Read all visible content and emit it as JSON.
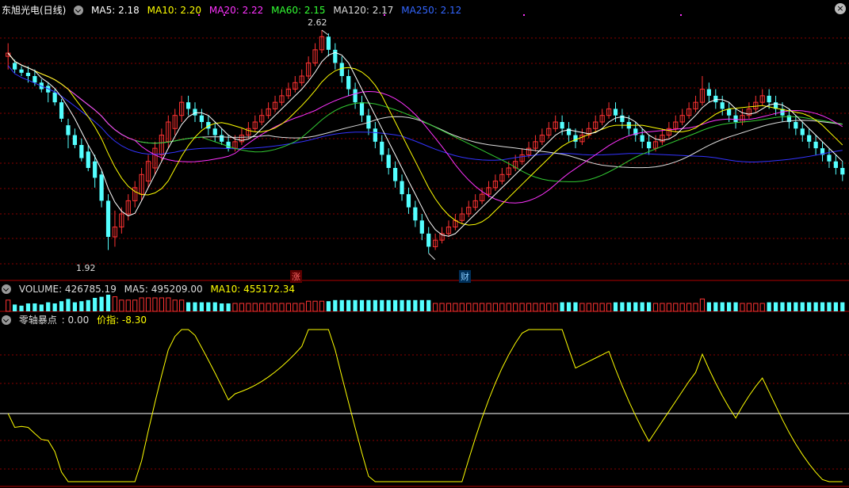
{
  "price_panel": {
    "stock_name": "东旭光电(日线)",
    "indicators": [
      {
        "label": "MA5: 2.18",
        "color": "#ffffff"
      },
      {
        "label": "MA10: 2.20",
        "color": "#ffff00"
      },
      {
        "label": "MA20: 2.22",
        "color": "#ff33ff"
      },
      {
        "label": "MA60: 2.15",
        "color": "#33ff33"
      },
      {
        "label": "MA120: 2.17",
        "color": "#dddddd"
      },
      {
        "label": "MA250: 2.12",
        "color": "#3366ff"
      }
    ],
    "high_label": "2.62",
    "low_label": "1.92",
    "tag_zhang": "涨",
    "tag_cai": "财",
    "close_icon": "close-icon"
  },
  "volume_panel": {
    "label": "VOLUME: 426785.19",
    "ma5": "MA5: 495209.00",
    "ma10": "MA10: 455172.34"
  },
  "osc_panel": {
    "name": "零轴暴点",
    "value": ": 0.00",
    "jiazhi": "价指: -8.30"
  },
  "colors": {
    "up": "#ff3232",
    "down": "#54ffff",
    "grid": "#8a0000",
    "ma5": "#ffffff",
    "ma10": "#ffff00",
    "ma20": "#ff33ff",
    "ma60": "#33cc33",
    "ma120": "#dddddd",
    "ma250": "#3333ff"
  },
  "chart_data": {
    "type": "candlestick",
    "price_range": [
      1.92,
      2.62
    ],
    "candles": [
      [
        2.54,
        2.55,
        2.5,
        2.58
      ],
      [
        2.52,
        2.5,
        2.49,
        2.53
      ],
      [
        2.5,
        2.49,
        2.48,
        2.51
      ],
      [
        2.49,
        2.48,
        2.46,
        2.51
      ],
      [
        2.48,
        2.46,
        2.45,
        2.5
      ],
      [
        2.46,
        2.44,
        2.43,
        2.47
      ],
      [
        2.45,
        2.43,
        2.4,
        2.46
      ],
      [
        2.43,
        2.4,
        2.39,
        2.44
      ],
      [
        2.4,
        2.35,
        2.34,
        2.41
      ],
      [
        2.33,
        2.3,
        2.26,
        2.35
      ],
      [
        2.3,
        2.27,
        2.26,
        2.32
      ],
      [
        2.27,
        2.23,
        2.22,
        2.29
      ],
      [
        2.25,
        2.2,
        2.19,
        2.27
      ],
      [
        2.22,
        2.17,
        2.14,
        2.24
      ],
      [
        2.18,
        2.1,
        2.08,
        2.19
      ],
      [
        2.1,
        1.99,
        1.95,
        2.12
      ],
      [
        1.99,
        2.02,
        1.96,
        2.07
      ],
      [
        2.02,
        2.06,
        2.0,
        2.08
      ],
      [
        2.06,
        2.1,
        2.04,
        2.12
      ],
      [
        2.1,
        2.14,
        2.08,
        2.16
      ],
      [
        2.12,
        2.18,
        2.1,
        2.2
      ],
      [
        2.16,
        2.22,
        2.14,
        2.24
      ],
      [
        2.2,
        2.26,
        2.18,
        2.28
      ],
      [
        2.24,
        2.3,
        2.22,
        2.32
      ],
      [
        2.28,
        2.34,
        2.26,
        2.36
      ],
      [
        2.32,
        2.36,
        2.3,
        2.38
      ],
      [
        2.36,
        2.4,
        2.34,
        2.42
      ],
      [
        2.4,
        2.38,
        2.36,
        2.42
      ],
      [
        2.38,
        2.36,
        2.34,
        2.4
      ],
      [
        2.36,
        2.34,
        2.32,
        2.38
      ],
      [
        2.34,
        2.32,
        2.3,
        2.36
      ],
      [
        2.32,
        2.3,
        2.28,
        2.34
      ],
      [
        2.3,
        2.28,
        2.27,
        2.32
      ],
      [
        2.28,
        2.26,
        2.25,
        2.3
      ],
      [
        2.26,
        2.28,
        2.25,
        2.3
      ],
      [
        2.28,
        2.3,
        2.27,
        2.32
      ],
      [
        2.3,
        2.32,
        2.29,
        2.34
      ],
      [
        2.32,
        2.34,
        2.31,
        2.36
      ],
      [
        2.34,
        2.36,
        2.33,
        2.38
      ],
      [
        2.36,
        2.38,
        2.35,
        2.4
      ],
      [
        2.38,
        2.4,
        2.37,
        2.42
      ],
      [
        2.4,
        2.42,
        2.39,
        2.44
      ],
      [
        2.42,
        2.44,
        2.41,
        2.46
      ],
      [
        2.44,
        2.46,
        2.43,
        2.48
      ],
      [
        2.46,
        2.48,
        2.45,
        2.5
      ],
      [
        2.48,
        2.52,
        2.47,
        2.54
      ],
      [
        2.52,
        2.56,
        2.51,
        2.58
      ],
      [
        2.56,
        2.6,
        2.55,
        2.62
      ],
      [
        2.6,
        2.56,
        2.54,
        2.61
      ],
      [
        2.56,
        2.52,
        2.5,
        2.58
      ],
      [
        2.52,
        2.48,
        2.46,
        2.54
      ],
      [
        2.48,
        2.44,
        2.42,
        2.5
      ],
      [
        2.44,
        2.4,
        2.38,
        2.46
      ],
      [
        2.4,
        2.36,
        2.34,
        2.42
      ],
      [
        2.36,
        2.32,
        2.3,
        2.38
      ],
      [
        2.32,
        2.28,
        2.26,
        2.34
      ],
      [
        2.28,
        2.24,
        2.22,
        2.3
      ],
      [
        2.24,
        2.2,
        2.18,
        2.26
      ],
      [
        2.2,
        2.16,
        2.14,
        2.22
      ],
      [
        2.16,
        2.12,
        2.1,
        2.18
      ],
      [
        2.12,
        2.08,
        2.06,
        2.14
      ],
      [
        2.08,
        2.04,
        2.02,
        2.1
      ],
      [
        2.04,
        2.0,
        1.98,
        2.06
      ],
      [
        2.0,
        1.96,
        1.94,
        2.02
      ],
      [
        1.96,
        1.98,
        1.95,
        2.0
      ],
      [
        1.98,
        2.0,
        1.97,
        2.02
      ],
      [
        2.0,
        2.02,
        1.99,
        2.04
      ],
      [
        2.02,
        2.04,
        2.01,
        2.06
      ],
      [
        2.04,
        2.06,
        2.03,
        2.08
      ],
      [
        2.06,
        2.08,
        2.05,
        2.1
      ],
      [
        2.08,
        2.1,
        2.07,
        2.12
      ],
      [
        2.1,
        2.12,
        2.09,
        2.14
      ],
      [
        2.12,
        2.14,
        2.11,
        2.16
      ],
      [
        2.14,
        2.16,
        2.13,
        2.18
      ],
      [
        2.16,
        2.18,
        2.15,
        2.2
      ],
      [
        2.18,
        2.2,
        2.17,
        2.22
      ],
      [
        2.2,
        2.22,
        2.19,
        2.24
      ],
      [
        2.22,
        2.24,
        2.21,
        2.26
      ],
      [
        2.24,
        2.26,
        2.23,
        2.28
      ],
      [
        2.26,
        2.28,
        2.25,
        2.3
      ],
      [
        2.28,
        2.3,
        2.27,
        2.32
      ],
      [
        2.3,
        2.32,
        2.29,
        2.34
      ],
      [
        2.32,
        2.34,
        2.31,
        2.36
      ],
      [
        2.34,
        2.32,
        2.3,
        2.36
      ],
      [
        2.32,
        2.3,
        2.28,
        2.34
      ],
      [
        2.3,
        2.28,
        2.26,
        2.32
      ],
      [
        2.28,
        2.3,
        2.27,
        2.32
      ],
      [
        2.3,
        2.32,
        2.29,
        2.34
      ],
      [
        2.32,
        2.34,
        2.31,
        2.36
      ],
      [
        2.34,
        2.36,
        2.33,
        2.38
      ],
      [
        2.36,
        2.38,
        2.35,
        2.4
      ],
      [
        2.38,
        2.36,
        2.34,
        2.4
      ],
      [
        2.36,
        2.34,
        2.32,
        2.38
      ],
      [
        2.34,
        2.32,
        2.3,
        2.36
      ],
      [
        2.32,
        2.3,
        2.28,
        2.34
      ],
      [
        2.3,
        2.28,
        2.26,
        2.32
      ],
      [
        2.28,
        2.26,
        2.24,
        2.3
      ],
      [
        2.26,
        2.28,
        2.25,
        2.3
      ],
      [
        2.28,
        2.3,
        2.27,
        2.32
      ],
      [
        2.3,
        2.32,
        2.29,
        2.34
      ],
      [
        2.32,
        2.34,
        2.31,
        2.36
      ],
      [
        2.34,
        2.36,
        2.33,
        2.38
      ],
      [
        2.36,
        2.38,
        2.35,
        2.4
      ],
      [
        2.38,
        2.4,
        2.37,
        2.42
      ],
      [
        2.4,
        2.44,
        2.39,
        2.48
      ],
      [
        2.44,
        2.42,
        2.4,
        2.46
      ],
      [
        2.42,
        2.4,
        2.38,
        2.44
      ],
      [
        2.4,
        2.38,
        2.36,
        2.42
      ],
      [
        2.38,
        2.36,
        2.34,
        2.4
      ],
      [
        2.36,
        2.34,
        2.32,
        2.38
      ],
      [
        2.34,
        2.36,
        2.33,
        2.38
      ],
      [
        2.36,
        2.38,
        2.35,
        2.4
      ],
      [
        2.38,
        2.4,
        2.37,
        2.42
      ],
      [
        2.4,
        2.42,
        2.39,
        2.44
      ],
      [
        2.42,
        2.4,
        2.38,
        2.44
      ],
      [
        2.4,
        2.38,
        2.36,
        2.42
      ],
      [
        2.38,
        2.36,
        2.34,
        2.4
      ],
      [
        2.36,
        2.34,
        2.32,
        2.38
      ],
      [
        2.34,
        2.32,
        2.3,
        2.36
      ],
      [
        2.32,
        2.3,
        2.28,
        2.34
      ],
      [
        2.3,
        2.28,
        2.26,
        2.32
      ],
      [
        2.28,
        2.26,
        2.24,
        2.3
      ],
      [
        2.26,
        2.24,
        2.22,
        2.28
      ],
      [
        2.24,
        2.22,
        2.2,
        2.26
      ],
      [
        2.22,
        2.2,
        2.18,
        2.24
      ],
      [
        2.2,
        2.18,
        2.16,
        2.22
      ]
    ]
  }
}
